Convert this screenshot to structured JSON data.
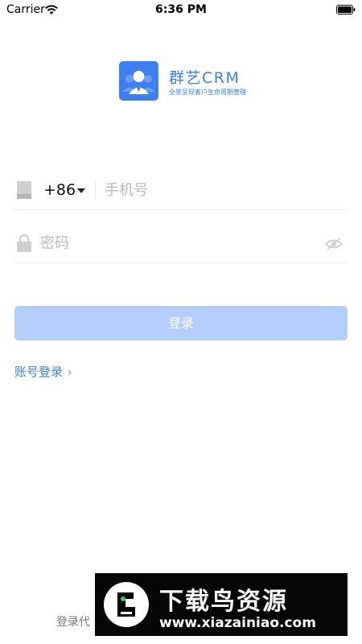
{
  "status_bar": {
    "carrier": "Carrier",
    "time": "6:36 PM",
    "icons": [
      "wifi-icon",
      "battery-icon"
    ]
  },
  "brand": {
    "name": "群艺CRM",
    "slogan": "全景呈现客户生命周期管理",
    "logo_icon": "user-avatar-icon",
    "accent_color": "#3d7ff0"
  },
  "login_form": {
    "country_code": "+86",
    "phone_placeholder": "手机号",
    "password_placeholder": "密码",
    "login_button": "登录",
    "login_button_color": "#b4cdfa",
    "icons": [
      "phone-icon",
      "lock-icon",
      "eye-hidden-icon",
      "caret-down-icon"
    ]
  },
  "links": {
    "account_login": "账号登录",
    "chevron": "›"
  },
  "footer": {
    "text": "登录代"
  },
  "watermark": {
    "title": "下载鸟资源",
    "url": "www.xiazainiao.com"
  }
}
